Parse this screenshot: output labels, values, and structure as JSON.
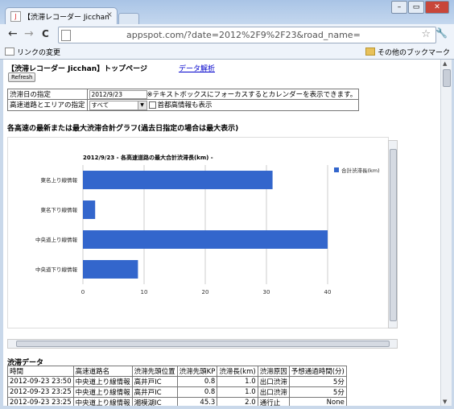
{
  "browser": {
    "tab_title": "【渋滞レコーダー Jicchan",
    "tab_close": "×",
    "favicon_label": "J",
    "window_buttons": [
      "–",
      "▭",
      "✕"
    ],
    "nav": {
      "back": "←",
      "forward": "→",
      "reload": "C"
    },
    "url": "appspot.com/?date=2012%2F9%2F23&road_name=",
    "star": "☆",
    "wrench": "🔧",
    "bookmarks": {
      "left_label": "リンクの変更",
      "right_label": "その他のブックマーク"
    }
  },
  "page": {
    "header": "【渋滞レコーダー Jicchan】トップページ",
    "analysis_link": "データ解析",
    "refresh_label": "Refresh",
    "form": {
      "date_label": "渋滞日の指定",
      "date_value": "2012/9/23",
      "date_hint": "※テキストボックスにフォーカスするとカレンダーを表示できます。",
      "road_label": "高速道路とエリアの指定",
      "road_select_value": "すべて",
      "metro_checkbox_label": "首都高情報も表示",
      "metro_checked": false
    },
    "graph_section_title": "各高速の最新または最大渋滞合計グラフ(過去日指定の場合は最大表示)",
    "data_section_title": "渋滞データ",
    "data_table": {
      "headers": [
        "時間",
        "高速道路名",
        "渋滞先頭位置",
        "渋滞先頭KP",
        "渋滞長(km)",
        "渋滞原因",
        "予想通過時間(分)"
      ],
      "rows": [
        [
          "2012-09-23 23:50",
          "中央道上り線情報",
          "高井戸IC",
          "0.8",
          "1.0",
          "出口渋滞",
          "5分"
        ],
        [
          "2012-09-23 23:25",
          "中央道上り線情報",
          "高井戸IC",
          "0.8",
          "1.0",
          "出口渋滞",
          "5分"
        ],
        [
          "2012-09-23 23:25",
          "中央道上り線情報",
          "湘模湖IC",
          "45.3",
          "2.0",
          "通行止",
          "None"
        ]
      ]
    }
  },
  "chart_data": {
    "type": "bar",
    "orientation": "horizontal",
    "title": "2012/9/23 - 各高速道路の最大合計渋滞長(km) -",
    "categories": [
      "東名上り線情報",
      "東名下り線情報",
      "中央道上り線情報",
      "中央道下り線情報"
    ],
    "series": [
      {
        "name": "合計渋滞長(km)",
        "values": [
          31,
          2,
          40,
          9
        ],
        "color": "#3366cc"
      }
    ],
    "xlim": [
      0,
      40
    ],
    "xticks": [
      0,
      10,
      20,
      30,
      40
    ],
    "grid": true,
    "legend_position": "right"
  }
}
